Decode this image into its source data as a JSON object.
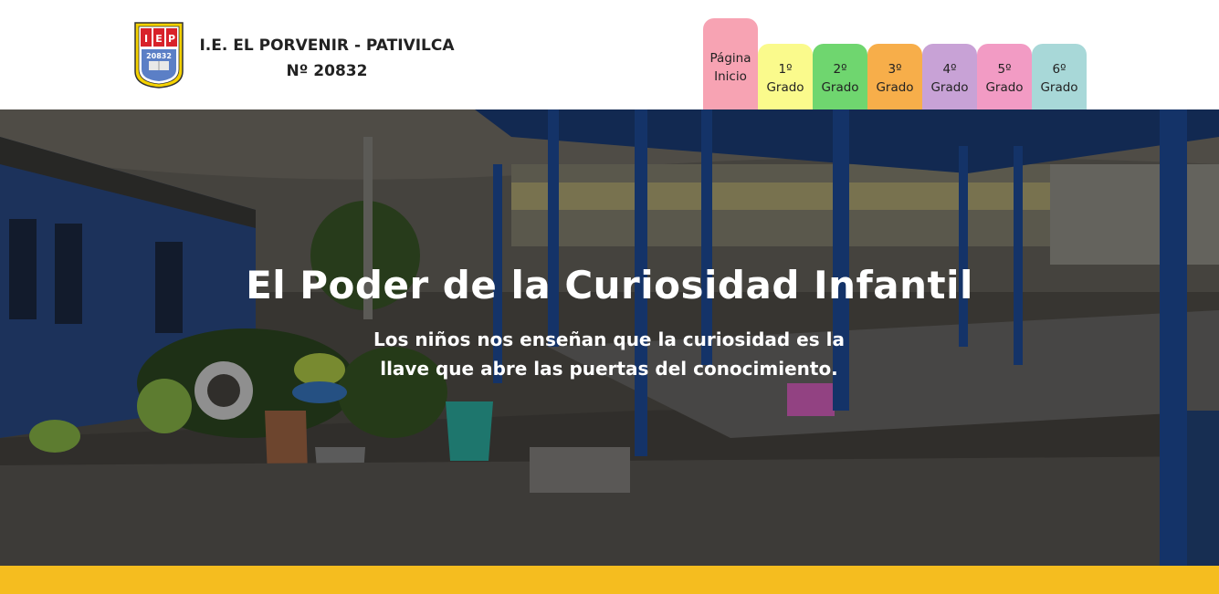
{
  "header": {
    "logo_text": "IEP",
    "logo_number": "20832",
    "school_line1": "I.E. EL PORVENIR - PATIVILCA",
    "school_line2": "Nº 20832"
  },
  "nav": {
    "tabs": [
      {
        "line1": "Página",
        "line2": "Inicio",
        "color": "#f7a3b3"
      },
      {
        "line1": "1º",
        "line2": "Grado",
        "color": "#fafa8c"
      },
      {
        "line1": "2º",
        "line2": "Grado",
        "color": "#6fd66f"
      },
      {
        "line1": "3º",
        "line2": "Grado",
        "color": "#f7ae4a"
      },
      {
        "line1": "4º",
        "line2": "Grado",
        "color": "#c8a2d6"
      },
      {
        "line1": "5º",
        "line2": "Grado",
        "color": "#f29bc4"
      },
      {
        "line1": "6º",
        "line2": "Grado",
        "color": "#a8d8d8"
      }
    ]
  },
  "hero": {
    "title": "El Poder de la Curiosidad Infantil",
    "subtitle": "Los niños nos enseñan que la curiosidad es la llave que abre las puertas del conocimiento."
  },
  "colors": {
    "band": "#f5bd1f",
    "structure_blue": "#1f4fa0"
  }
}
